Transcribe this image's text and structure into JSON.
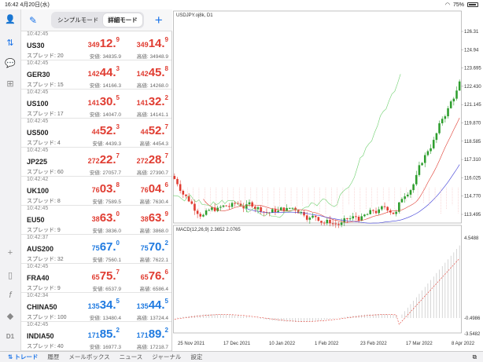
{
  "status": {
    "time": "16:42",
    "date": "4月20日(水)",
    "battery": "75%"
  },
  "toolbar": {
    "mode_simple": "シンプルモード",
    "mode_detail": "詳細モード"
  },
  "quotes": [
    {
      "time": "10:42:45",
      "symbol": "US30",
      "spread": "スプレッド: 20",
      "bid_small": "349",
      "bid_big": "12.",
      "bid_sup": "9",
      "ask_small": "349",
      "ask_big": "14.",
      "ask_sup": "9",
      "low": "安値: 34835.9",
      "high": "高値: 34948.9",
      "color": "red"
    },
    {
      "time": "10:42:45",
      "symbol": "GER30",
      "spread": "スプレッド: 15",
      "bid_small": "142",
      "bid_big": "44.",
      "bid_sup": "3",
      "ask_small": "142",
      "ask_big": "45.",
      "ask_sup": "8",
      "low": "安値: 14166.3",
      "high": "高値: 14268.0",
      "color": "red"
    },
    {
      "time": "10:42:45",
      "symbol": "US100",
      "spread": "スプレッド: 17",
      "bid_small": "141",
      "bid_big": "30.",
      "bid_sup": "5",
      "ask_small": "141",
      "ask_big": "32.",
      "ask_sup": "2",
      "low": "安値: 14047.0",
      "high": "高値: 14141.1",
      "color": "red"
    },
    {
      "time": "10:42:45",
      "symbol": "US500",
      "spread": "スプレッド: 4",
      "bid_small": "44",
      "bid_big": "52.",
      "bid_sup": "3",
      "ask_small": "44",
      "ask_big": "52.",
      "ask_sup": "7",
      "low": "安値: 4439.3",
      "high": "高値: 4454.3",
      "color": "red"
    },
    {
      "time": "10:42:45",
      "symbol": "JP225",
      "spread": "スプレッド: 60",
      "bid_small": "272",
      "bid_big": "22.",
      "bid_sup": "7",
      "ask_small": "272",
      "ask_big": "28.",
      "ask_sup": "7",
      "low": "安値: 27057.7",
      "high": "高値: 27390.7",
      "color": "red"
    },
    {
      "time": "10:42:42",
      "symbol": "UK100",
      "spread": "スプレッド: 8",
      "bid_small": "76",
      "bid_big": "03.",
      "bid_sup": "8",
      "ask_small": "76",
      "ask_big": "04.",
      "ask_sup": "6",
      "low": "安値: 7589.5",
      "high": "高値: 7630.4",
      "color": "red"
    },
    {
      "time": "10:42:45",
      "symbol": "EU50",
      "spread": "スプレッド: 9",
      "bid_small": "38",
      "bid_big": "63.",
      "bid_sup": "0",
      "ask_small": "38",
      "ask_big": "63.",
      "ask_sup": "9",
      "low": "安値: 3836.0",
      "high": "高値: 3868.0",
      "color": "red"
    },
    {
      "time": "10:42:37",
      "symbol": "AUS200",
      "spread": "スプレッド: 32",
      "bid_small": "75",
      "bid_big": "67.",
      "bid_sup": "0",
      "ask_small": "75",
      "ask_big": "70.",
      "ask_sup": "2",
      "low": "安値: 7560.1",
      "high": "高値: 7622.1",
      "color": "blue"
    },
    {
      "time": "10:42:45",
      "symbol": "FRA40",
      "spread": "スプレッド: 9",
      "bid_small": "65",
      "bid_big": "75.",
      "bid_sup": "7",
      "ask_small": "65",
      "ask_big": "76.",
      "ask_sup": "6",
      "low": "安値: 6537.9",
      "high": "高値: 6586.4",
      "color": "red"
    },
    {
      "time": "10:42:34",
      "symbol": "CHINA50",
      "spread": "スプレッド: 100",
      "bid_small": "135",
      "bid_big": "34.",
      "bid_sup": "5",
      "ask_small": "135",
      "ask_big": "44.",
      "ask_sup": "5",
      "low": "安値: 13480.4",
      "high": "高値: 13724.4",
      "color": "blue"
    },
    {
      "time": "10:42:45",
      "symbol": "INDIA50",
      "spread": "スプレッド: 40",
      "bid_small": "171",
      "bid_big": "85.",
      "bid_sup": "2",
      "ask_small": "171",
      "ask_big": "89.",
      "ask_sup": "2",
      "low": "安値: 16977.3",
      "high": "高値: 17218.7",
      "color": "blue"
    }
  ],
  "chart": {
    "title": "USDJPY.oj8k, D1",
    "macd_label": "MACD(12,26,9) 2.3652 2.0765",
    "price_ticks": [
      "126.31",
      "124.94",
      "123.695",
      "122.430",
      "121.145",
      "119.870",
      "118.585",
      "117.310",
      "116.025",
      "114.770",
      "113.495"
    ],
    "macd_ticks": [
      "4.5488",
      "-0.4986",
      "-3.5482"
    ],
    "date_ticks": [
      "25 Nov 2021",
      "17 Dec 2021",
      "10 Jan 2022",
      "1 Feb 2022",
      "23 Feb 2022",
      "17 Mar 2022",
      "8 Apr 2022"
    ],
    "candle_up": "#2e9e2e",
    "candle_down": "#e03c31"
  },
  "tabs": [
    {
      "label": "トレード",
      "active": true
    },
    {
      "label": "履歴",
      "active": false
    },
    {
      "label": "メールボックス",
      "active": false
    },
    {
      "label": "ニュース",
      "active": false
    },
    {
      "label": "ジャーナル",
      "active": false
    },
    {
      "label": "設定",
      "active": false
    }
  ]
}
